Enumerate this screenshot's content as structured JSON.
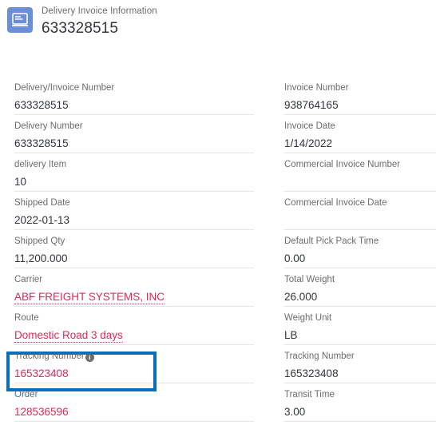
{
  "header": {
    "icon": "delivery-document-icon",
    "subtitle": "Delivery Invoice Information",
    "title": "633328515"
  },
  "colors": {
    "accent_link": "#e2285a",
    "highlight_border": "#0a6ebd",
    "icon_background": "#6c8ed8",
    "label_text": "#6a6d70",
    "value_text": "#32363a",
    "divider": "#e5e5e5"
  },
  "form": {
    "left_column": [
      {
        "label": "Delivery/Invoice Number",
        "value": "633328515",
        "style": "plain-text",
        "info": false
      },
      {
        "label": "Delivery Number",
        "value": "633328515",
        "style": "plain-text",
        "info": false
      },
      {
        "label": "delivery Item",
        "value": "10",
        "style": "plain-text",
        "info": false
      },
      {
        "label": "Shipped Date",
        "value": "2022-01-13",
        "style": "plain-text",
        "info": false
      },
      {
        "label": "Shipped Qty",
        "value": "11,200.000",
        "style": "plain-text",
        "info": false
      },
      {
        "label": "Carrier",
        "value": "ABF FREIGHT SYSTEMS, INC",
        "style": "link-dotted",
        "info": false
      },
      {
        "label": "Route",
        "value": "Domestic Road 3 days",
        "style": "link-dotted",
        "info": false
      },
      {
        "label": "Tracking Number",
        "value": "165323408",
        "style": "link-plain",
        "info": true
      },
      {
        "label": "Order",
        "value": "128536596",
        "style": "link-plain",
        "info": false
      }
    ],
    "right_column": [
      {
        "label": "Invoice Number",
        "value": "938764165",
        "style": "plain-text",
        "info": false
      },
      {
        "label": "Invoice Date",
        "value": "1/14/2022",
        "style": "plain-text",
        "info": false
      },
      {
        "label": "Commercial Invoice Number",
        "value": "",
        "style": "plain-text",
        "info": false
      },
      {
        "label": "Commercial Invoice Date",
        "value": "",
        "style": "plain-text",
        "info": false
      },
      {
        "label": "Default Pick Pack Time",
        "value": "0.00",
        "style": "plain-text",
        "info": false
      },
      {
        "label": "Total Weight",
        "value": "26.000",
        "style": "plain-text",
        "info": false
      },
      {
        "label": "Weight Unit",
        "value": "LB",
        "style": "plain-text",
        "info": false
      },
      {
        "label": "Tracking Number",
        "value": "165323408",
        "style": "plain-text",
        "info": false
      },
      {
        "label": "Transit Time",
        "value": "3.00",
        "style": "plain-text",
        "info": false
      }
    ]
  },
  "highlight": {
    "target_field": "Tracking Number",
    "info_glyph": "i"
  }
}
